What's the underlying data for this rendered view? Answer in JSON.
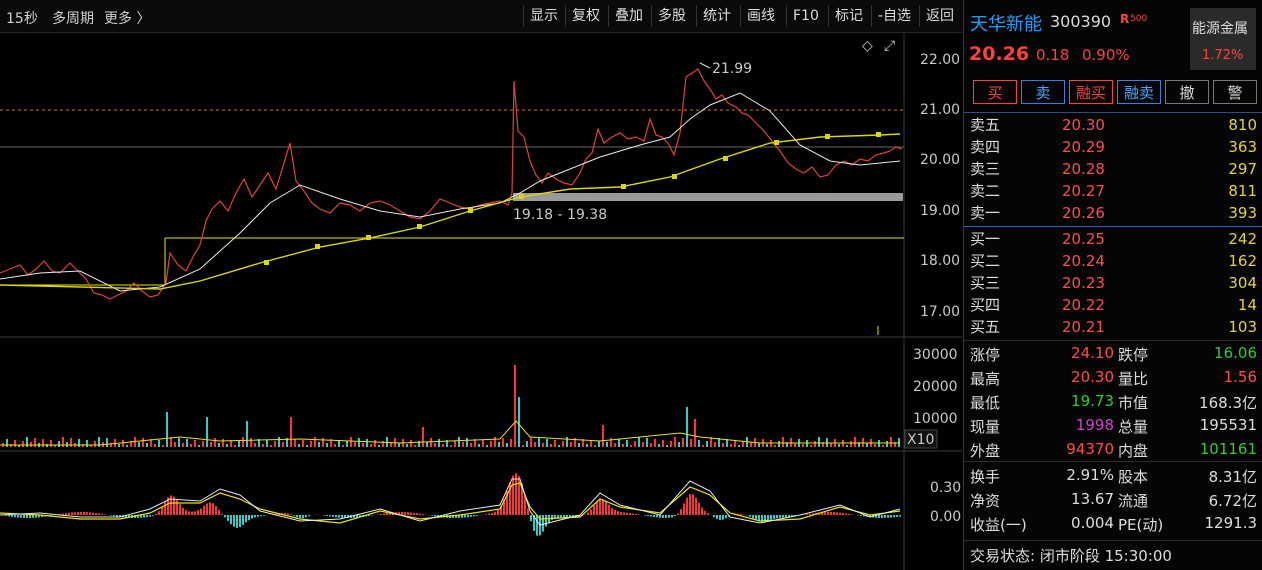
{
  "toolbar": {
    "periods": [
      "15秒",
      "多周期",
      "更多 〉"
    ],
    "buttons": [
      "显示",
      "复权",
      "叠加",
      "多股",
      "统计",
      "画线",
      "F10",
      "标记",
      "-自选",
      "返回"
    ]
  },
  "chart": {
    "price_axis": [
      "22.00",
      "21.00",
      "20.00",
      "19.00",
      "18.00",
      "17.00"
    ],
    "volume_axis": [
      "30000",
      "20000",
      "10000"
    ],
    "volume_scale": "X10",
    "macd_axis": [
      "0.30",
      "0.00"
    ],
    "peak_label": "21.99",
    "range_label": "19.18 - 19.38",
    "diamond": "◇",
    "expand": "⤢"
  },
  "stock": {
    "name": "天华新能",
    "code": "300390",
    "flag": "R",
    "flag_sub": "500",
    "price": "20.26",
    "change": "0.18",
    "change_pct": "0.90%",
    "sector_name": "能源金属",
    "sector_pct": "1.72%"
  },
  "actions": [
    "买",
    "卖",
    "融买",
    "融卖",
    "撤",
    "警"
  ],
  "sell_orders": [
    {
      "label": "卖五",
      "price": "20.30",
      "qty": "810"
    },
    {
      "label": "卖四",
      "price": "20.29",
      "qty": "363"
    },
    {
      "label": "卖三",
      "price": "20.28",
      "qty": "297"
    },
    {
      "label": "卖二",
      "price": "20.27",
      "qty": "811"
    },
    {
      "label": "卖一",
      "price": "20.26",
      "qty": "393"
    }
  ],
  "buy_orders": [
    {
      "label": "买一",
      "price": "20.25",
      "qty": "242"
    },
    {
      "label": "买二",
      "price": "20.24",
      "qty": "162"
    },
    {
      "label": "买三",
      "price": "20.23",
      "qty": "304"
    },
    {
      "label": "买四",
      "price": "20.22",
      "qty": "14"
    },
    {
      "label": "买五",
      "price": "20.21",
      "qty": "103"
    }
  ],
  "stats": [
    {
      "k1": "涨停",
      "v1": "24.10",
      "c1": "#ff4d4d",
      "k2": "跌停",
      "v2": "16.06",
      "c2": "#33cc33"
    },
    {
      "k1": "最高",
      "v1": "20.30",
      "c1": "#ff4d4d",
      "k2": "量比",
      "v2": "1.56",
      "c2": "#ff4d4d"
    },
    {
      "k1": "最低",
      "v1": "19.73",
      "c1": "#33cc33",
      "k2": "市值",
      "v2": "168.3亿",
      "c2": "#dcdcdc"
    },
    {
      "k1": "现量",
      "v1": "1998",
      "c1": "#d040d0",
      "k2": "总量",
      "v2": "195531",
      "c2": "#dcdcdc"
    },
    {
      "k1": "外盘",
      "v1": "94370",
      "c1": "#ff4d4d",
      "k2": "内盘",
      "v2": "101161",
      "c2": "#33cc33"
    }
  ],
  "fundamentals": [
    {
      "k1": "换手",
      "v1": "2.91%",
      "k2": "股本",
      "v2": "8.31亿"
    },
    {
      "k1": "净资",
      "v1": "13.67",
      "k2": "流通",
      "v2": "6.72亿"
    },
    {
      "k1": "收益(一)",
      "v1": "0.004",
      "k2": "PE(动)",
      "v2": "1291.3"
    }
  ],
  "status": "交易状态: 闭市阶段 15:30:00",
  "colors": {
    "up": "#ff3333",
    "down": "#33cccc",
    "ma_white": "#e8e8e8",
    "ma_yellow": "#e6e600",
    "accent_blue": "#1a56c8"
  }
}
